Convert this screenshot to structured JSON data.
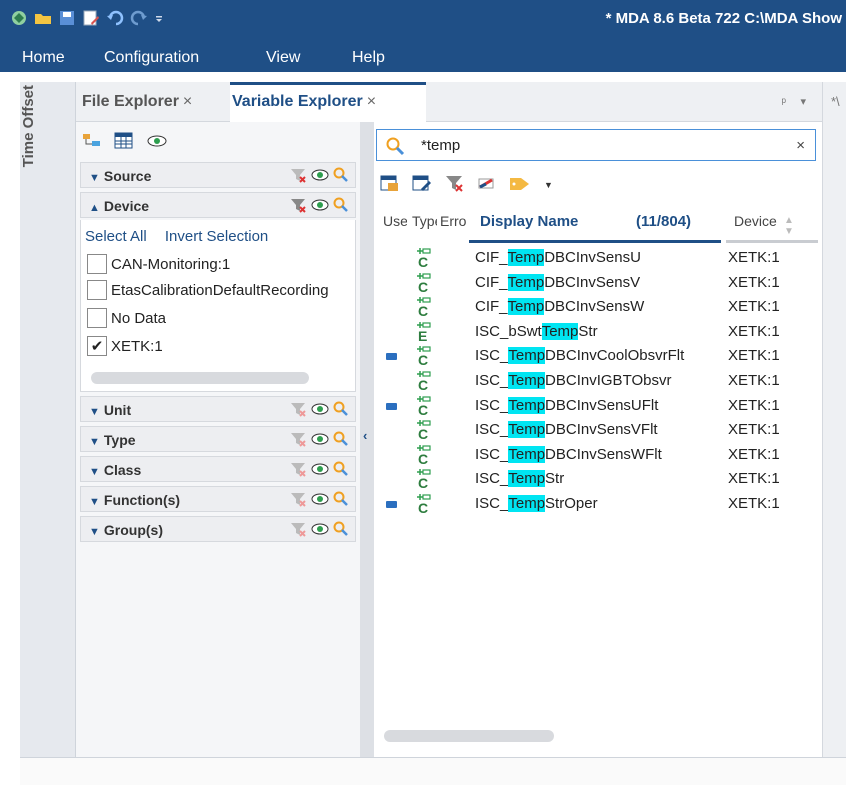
{
  "window": {
    "title": "* MDA 8.6 Beta 722 C:\\MDA Show"
  },
  "quick_access": [
    "app-icon",
    "open-folder-icon",
    "save-icon",
    "save-as-icon",
    "undo-icon",
    "redo-icon",
    "customize-icon"
  ],
  "menu": [
    "Home",
    "Configuration",
    "View",
    "Help"
  ],
  "side_strip": {
    "label": "Time Offset"
  },
  "tabs": [
    {
      "label": "File Explorer",
      "close": "×"
    },
    {
      "label": "Variable Explorer",
      "close": "×"
    }
  ],
  "tab_controls": {
    "pin": "ᵖ",
    "menu": "▾"
  },
  "right_tab_fragment": "*\\",
  "filters": {
    "toolbar": [
      "hierarchy-icon",
      "table-view-icon",
      "visibility-icon"
    ],
    "sections": [
      {
        "label": "Source",
        "expanded": false
      },
      {
        "label": "Device",
        "expanded": true
      },
      {
        "label": "Unit",
        "expanded": false
      },
      {
        "label": "Type",
        "expanded": false
      },
      {
        "label": "Class",
        "expanded": false
      },
      {
        "label": "Function(s)",
        "expanded": false
      },
      {
        "label": "Group(s)",
        "expanded": false
      }
    ],
    "device": {
      "select_all": "Select All",
      "invert_selection": "Invert Selection",
      "items": [
        {
          "label": "CAN-Monitoring:1",
          "checked": false
        },
        {
          "label": "EtasCalibrationDefaultRecording",
          "checked": false
        },
        {
          "label": "No Data",
          "checked": false
        },
        {
          "label": "XETK:1",
          "checked": true
        }
      ]
    }
  },
  "search": {
    "value": "*temp",
    "clear": "×"
  },
  "list_toolbar": [
    "add-variables-icon",
    "edit-variables-icon",
    "clear-filter-icon",
    "color-icon",
    "tag-icon",
    "dropdown-arrow-icon"
  ],
  "columns": {
    "use": "Use",
    "type": "Type",
    "error": "Error",
    "display_name": "Display Name",
    "count": "(11/804)",
    "device": "Device"
  },
  "rows": [
    {
      "used": false,
      "type": "C",
      "pre": "CIF_",
      "hl": "Temp",
      "post": "DBCInvSensU",
      "device": "XETK:1"
    },
    {
      "used": false,
      "type": "C",
      "pre": "CIF_",
      "hl": "Temp",
      "post": "DBCInvSensV",
      "device": "XETK:1"
    },
    {
      "used": false,
      "type": "C",
      "pre": "CIF_",
      "hl": "Temp",
      "post": "DBCInvSensW",
      "device": "XETK:1"
    },
    {
      "used": false,
      "type": "E",
      "pre": "ISC_bSwt",
      "hl": "Temp",
      "post": "Str",
      "device": "XETK:1"
    },
    {
      "used": true,
      "type": "C",
      "pre": "ISC_",
      "hl": "Temp",
      "post": "DBCInvCoolObsvrFlt",
      "device": "XETK:1"
    },
    {
      "used": false,
      "type": "C",
      "pre": "ISC_",
      "hl": "Temp",
      "post": "DBCInvIGBTObsvr",
      "device": "XETK:1"
    },
    {
      "used": true,
      "type": "C",
      "pre": "ISC_",
      "hl": "Temp",
      "post": "DBCInvSensUFlt",
      "device": "XETK:1"
    },
    {
      "used": false,
      "type": "C",
      "pre": "ISC_",
      "hl": "Temp",
      "post": "DBCInvSensVFlt",
      "device": "XETK:1"
    },
    {
      "used": false,
      "type": "C",
      "pre": "ISC_",
      "hl": "Temp",
      "post": "DBCInvSensWFlt",
      "device": "XETK:1"
    },
    {
      "used": false,
      "type": "C",
      "pre": "ISC_",
      "hl": "Temp",
      "post": "Str",
      "device": "XETK:1"
    },
    {
      "used": true,
      "type": "C",
      "pre": "ISC_",
      "hl": "Temp",
      "post": "StrOper",
      "device": "XETK:1"
    }
  ],
  "colors": {
    "accent": "#1f4f86",
    "highlight": "#00e5f2",
    "use_marker": "#2b6fbf"
  }
}
